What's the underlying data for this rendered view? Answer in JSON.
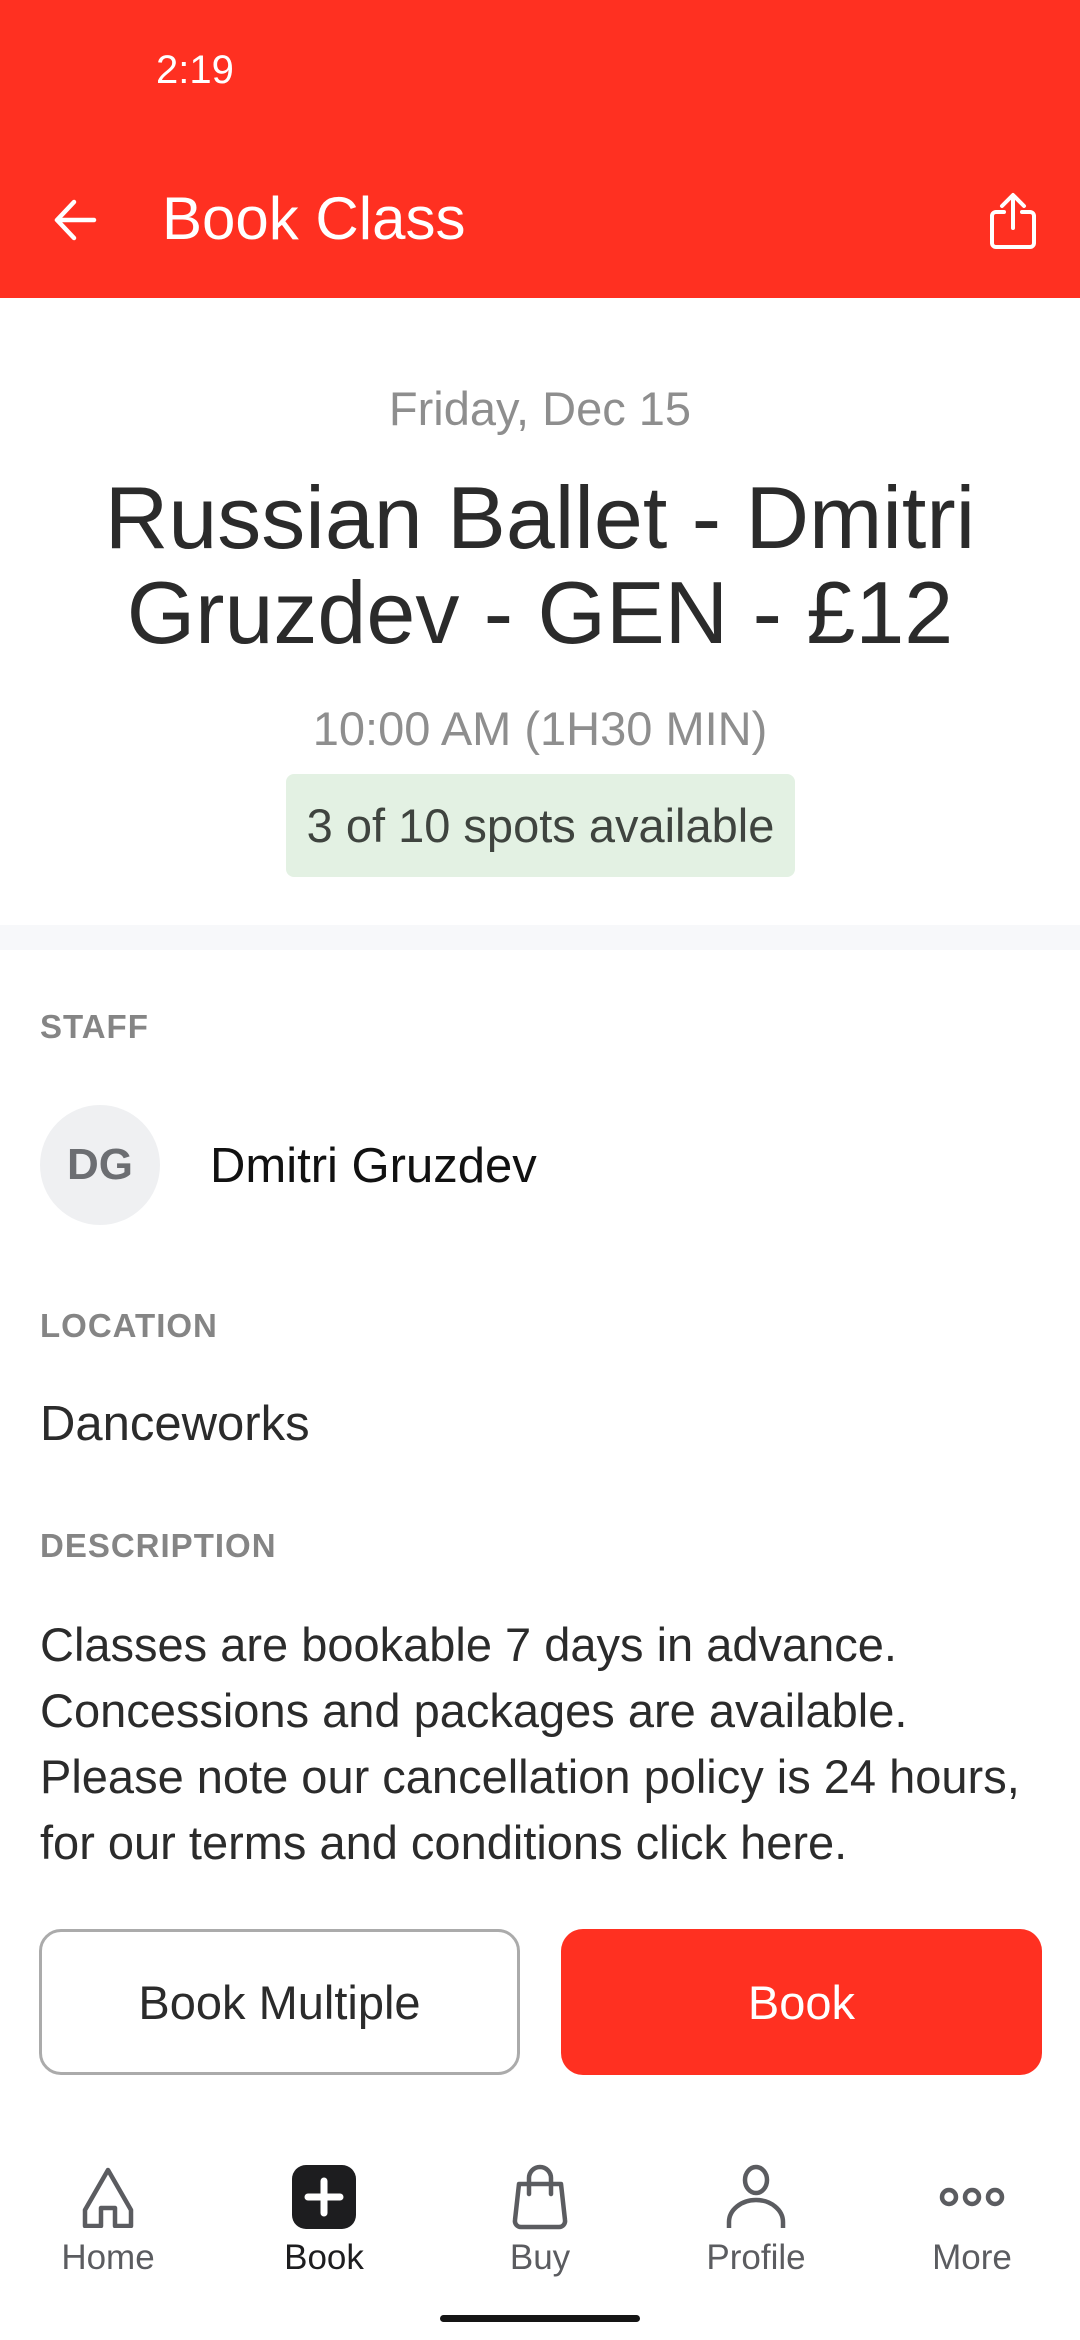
{
  "status_bar": {
    "time": "2:19"
  },
  "header": {
    "title": "Book Class",
    "back_icon": "arrow-left-icon",
    "share_icon": "share-icon",
    "color": "#FF3021"
  },
  "class": {
    "date": "Friday, Dec 15",
    "title": "Russian Ballet - Dmitri Gruzdev - GEN - £12",
    "time": "10:00 AM (1H30 MIN)",
    "availability": "3 of 10 spots available",
    "spots_available": 3,
    "spots_total": 10
  },
  "staff": {
    "label": "STAFF",
    "initials": "DG",
    "name": "Dmitri Gruzdev"
  },
  "location": {
    "label": "LOCATION",
    "value": "Danceworks"
  },
  "description": {
    "label": "DESCRIPTION",
    "text": "Classes are bookable 7 days in advance. Concessions and packages are available. Please note our cancellation policy is 24 hours, for our terms and conditions click here."
  },
  "actions": {
    "book_multiple": "Book Multiple",
    "book": "Book"
  },
  "bottom_nav": {
    "items": [
      {
        "label": "Home",
        "icon": "home-icon",
        "active": false
      },
      {
        "label": "Book",
        "icon": "book-plus-icon",
        "active": true
      },
      {
        "label": "Buy",
        "icon": "shopping-bag-icon",
        "active": false
      },
      {
        "label": "Profile",
        "icon": "person-icon",
        "active": false
      },
      {
        "label": "More",
        "icon": "more-dots-icon",
        "active": false
      }
    ]
  }
}
